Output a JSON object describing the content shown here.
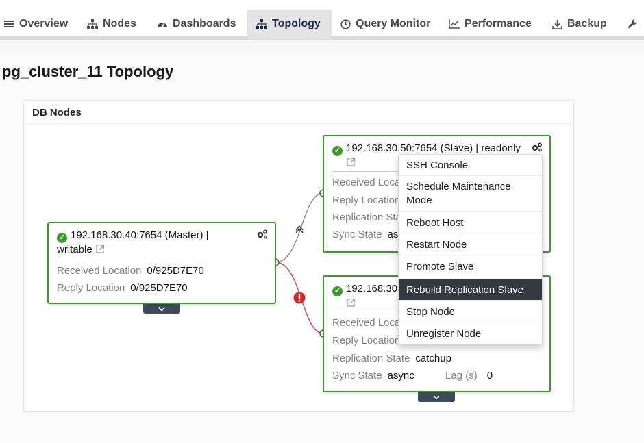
{
  "nav": {
    "tabs": [
      {
        "label": "Overview",
        "icon": "list-icon"
      },
      {
        "label": "Nodes",
        "icon": "hierarchy-icon"
      },
      {
        "label": "Dashboards",
        "icon": "dashboard-icon"
      },
      {
        "label": "Topology",
        "icon": "topology-icon",
        "active": true
      },
      {
        "label": "Query Monitor",
        "icon": "clock-icon"
      },
      {
        "label": "Performance",
        "icon": "line-chart-icon"
      },
      {
        "label": "Backup",
        "icon": "download-icon"
      },
      {
        "label": "",
        "icon": "wrench-icon"
      }
    ]
  },
  "page": {
    "title": "pg_cluster_11 Topology"
  },
  "panel": {
    "title": "DB Nodes"
  },
  "master": {
    "title_line1": "192.168.30.40:7654 (Master) |",
    "title_line2": "writable",
    "received_label": "Received Location",
    "received_value": "0/925D7E70",
    "reply_label": "Reply Location",
    "reply_value": "0/925D7E70"
  },
  "slave1": {
    "title": "192.168.30.50:7654 (Slave) | readonly",
    "received_label": "Received Loca",
    "reply_label": "Reply Location",
    "replication_label": "Replication Sta",
    "sync_label": "Sync State",
    "sync_value": "as"
  },
  "slave2": {
    "title": "192.168.30",
    "received_label": "Received Loca",
    "reply_label": "Reply Location",
    "replication_label": "Replication State",
    "replication_value": "catchup",
    "sync_label": "Sync State",
    "sync_value": "async",
    "lag_label": "Lag (s)",
    "lag_value": "0"
  },
  "context_menu": {
    "items": [
      "SSH Console",
      "Schedule Maintenance Mode",
      "Reboot Host",
      "Restart Node",
      "Promote Slave",
      "Rebuild Replication Slave",
      "Stop Node",
      "Unregister Node"
    ],
    "selected": "Rebuild Replication Slave"
  },
  "colors": {
    "node_border": "#3d9a2c",
    "status_ok": "#3d9a2c",
    "status_error": "#d9262e",
    "link_ok": "#8a8a8a",
    "link_error": "#e04040",
    "menu_selected_bg": "#343a40"
  }
}
